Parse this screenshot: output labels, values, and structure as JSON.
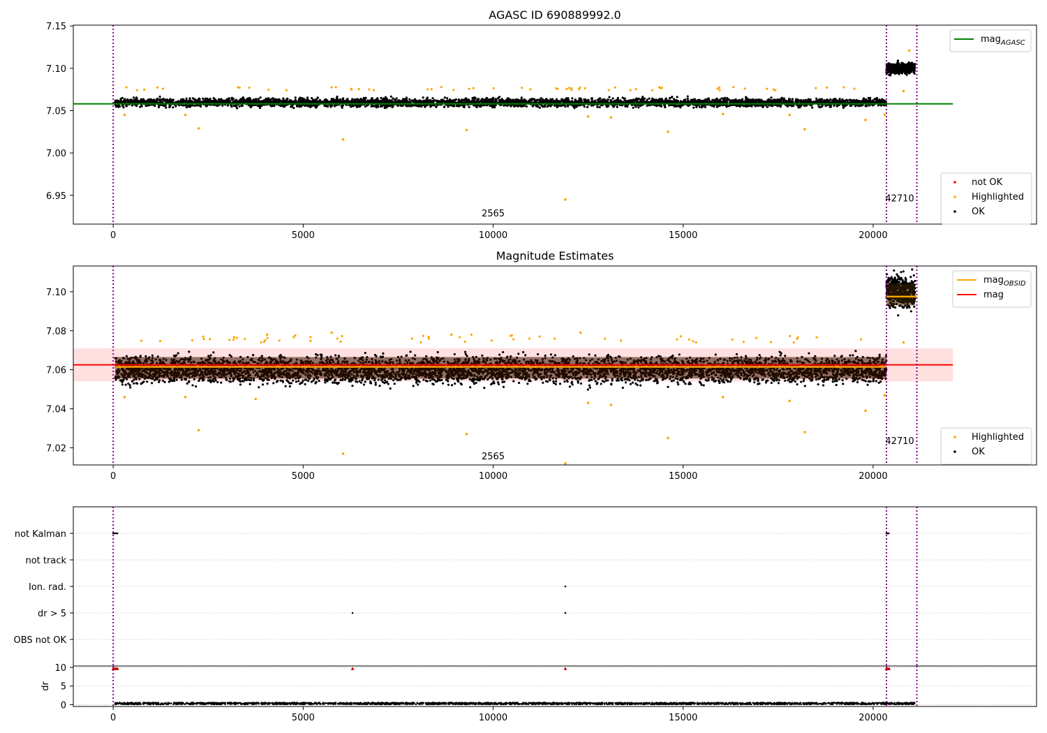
{
  "figure": {
    "title": "AGASC ID 690889992.0"
  },
  "chart_data": [
    {
      "type": "scatter",
      "title": "AGASC ID 690889992.0",
      "xlim": [
        -1050,
        24300
      ],
      "ylim": [
        6.916,
        7.151
      ],
      "x_ticks": [
        0,
        5000,
        10000,
        15000,
        20000
      ],
      "y_ticks": [
        6.95,
        7.0,
        7.05,
        7.1,
        7.15
      ],
      "y_tick_labels": [
        "6.95",
        "7.00",
        "7.05",
        "7.10",
        "7.15"
      ],
      "grid": false,
      "legend_upper": {
        "placement": "upper right",
        "entries": [
          {
            "label": "mag",
            "subscript": "AGASC",
            "color": "#008000"
          }
        ]
      },
      "legend_lower": {
        "placement": "lower right",
        "entries": [
          {
            "label": "not OK",
            "color": "#ff0000"
          },
          {
            "label": "Highlighted",
            "color": "#ffa500"
          },
          {
            "label": "OK",
            "color": "#000000"
          }
        ]
      },
      "series": [
        {
          "name": "mag",
          "kind": "hline",
          "y": 7.058,
          "x": [
            -1050,
            22100
          ],
          "color": "#008000"
        },
        {
          "name": "OK",
          "kind": "band_points",
          "color": "#000000",
          "segments": [
            {
              "x": [
                50,
                20350
              ],
              "y_center": 7.0595,
              "y_halfwidth": 0.0075
            },
            {
              "x": [
                20350,
                21100
              ],
              "y_center": 7.1,
              "y_halfwidth": 0.01
            }
          ]
        },
        {
          "name": "Highlighted",
          "kind": "points",
          "color": "#ffa500",
          "points": [
            [
              300,
              7.045
            ],
            [
              2250,
              7.029
            ],
            [
              6050,
              7.016
            ],
            [
              9300,
              7.027
            ],
            [
              11900,
              6.945
            ],
            [
              14600,
              7.025
            ],
            [
              18200,
              7.028
            ],
            [
              19800,
              7.039
            ],
            [
              20800,
              7.073
            ],
            [
              20950,
              7.121
            ],
            [
              12500,
              7.043
            ],
            [
              13100,
              7.042
            ],
            [
              1900,
              7.045
            ],
            [
              16050,
              7.046
            ],
            [
              17800,
              7.045
            ],
            [
              20300,
              7.045
            ]
          ]
        }
      ],
      "annotations": [
        {
          "text": "2565",
          "x": 10000,
          "y": 6.925
        },
        {
          "text": "42710",
          "x": 20700,
          "y": 6.943
        }
      ],
      "vlines": [
        {
          "x": 0,
          "color": "#800080",
          "style": "dotted"
        },
        {
          "x": 20350,
          "color": "#800080",
          "style": "dotted"
        },
        {
          "x": 21150,
          "color": "#800080",
          "style": "dotted"
        }
      ]
    },
    {
      "type": "scatter",
      "title": "Magnitude Estimates",
      "xlim": [
        -1050,
        24300
      ],
      "ylim": [
        7.0112,
        7.1132
      ],
      "x_ticks": [
        0,
        5000,
        10000,
        15000,
        20000
      ],
      "y_ticks": [
        7.02,
        7.04,
        7.06,
        7.08,
        7.1
      ],
      "y_tick_labels": [
        "7.02",
        "7.04",
        "7.06",
        "7.08",
        "7.10"
      ],
      "grid": false,
      "legend_upper": {
        "placement": "upper right",
        "entries": [
          {
            "label": "mag",
            "subscript": "OBSID",
            "color": "#ffa500"
          },
          {
            "label": "mag",
            "subscript": "",
            "color": "#ff0000"
          }
        ]
      },
      "legend_lower": {
        "placement": "lower right",
        "entries": [
          {
            "label": "Highlighted",
            "color": "#ffa500"
          },
          {
            "label": "OK",
            "color": "#000000"
          }
        ]
      },
      "series": [
        {
          "name": "mag",
          "kind": "hline",
          "y": 7.0625,
          "x": [
            -1050,
            22100
          ],
          "color": "#ff0000",
          "band": [
            7.054,
            7.071
          ]
        },
        {
          "name": "mag_OBSID",
          "kind": "segments",
          "color": "#ffa500",
          "segments": [
            {
              "x": [
                50,
                20350
              ],
              "y": 7.0615
            },
            {
              "x": [
                20350,
                21150
              ],
              "y": 7.0975
            }
          ]
        },
        {
          "name": "OK",
          "kind": "band_points",
          "color": "#000000",
          "segments": [
            {
              "x": [
                50,
                20350
              ],
              "y_center": 7.06,
              "y_halfwidth": 0.0105
            },
            {
              "x": [
                20350,
                21100
              ],
              "y_center": 7.1,
              "y_halfwidth": 0.012
            }
          ]
        },
        {
          "name": "Highlighted",
          "kind": "points",
          "color": "#ffa500",
          "points": [
            [
              300,
              7.046
            ],
            [
              1900,
              7.046
            ],
            [
              2250,
              7.029
            ],
            [
              3750,
              7.045
            ],
            [
              6050,
              7.017
            ],
            [
              9300,
              7.027
            ],
            [
              11900,
              7.012
            ],
            [
              12500,
              7.043
            ],
            [
              13100,
              7.042
            ],
            [
              14600,
              7.025
            ],
            [
              16050,
              7.046
            ],
            [
              17800,
              7.044
            ],
            [
              18200,
              7.028
            ],
            [
              19800,
              7.039
            ],
            [
              20300,
              7.047
            ],
            [
              20800,
              7.074
            ],
            [
              5750,
              7.079
            ],
            [
              4050,
              7.078
            ],
            [
              8900,
              7.078
            ],
            [
              12300,
              7.079
            ]
          ]
        }
      ],
      "annotations": [
        {
          "text": "2565",
          "x": 10000,
          "y": 7.014
        },
        {
          "text": "42710",
          "x": 20700,
          "y": 7.022
        }
      ],
      "vlines": [
        {
          "x": 0,
          "color": "#800080",
          "style": "dotted"
        },
        {
          "x": 20350,
          "color": "#800080",
          "style": "dotted"
        },
        {
          "x": 21150,
          "color": "#800080",
          "style": "dotted"
        }
      ]
    },
    {
      "type": "scatter",
      "title": "",
      "xlim": [
        -1050,
        24300
      ],
      "x_ticks": [
        0,
        5000,
        10000,
        15000,
        20000
      ],
      "flags": {
        "categories": [
          "not Kalman",
          "not track",
          "Ion. rad.",
          "dr > 5",
          "OBS not OK"
        ],
        "points": [
          {
            "category": "not Kalman",
            "x": [
              0,
              40,
              80,
              110,
              20350,
              20380,
              20410
            ]
          },
          {
            "category": "Ion. rad.",
            "x": [
              11900
            ]
          },
          {
            "category": "dr > 5",
            "x": [
              6300,
              11900
            ]
          }
        ]
      },
      "dr": {
        "ylabel": "dr",
        "ylim": [
          -0.5,
          10.4
        ],
        "y_ticks": [
          0,
          5,
          10
        ],
        "y_tick_labels": [
          "0",
          "5",
          "10"
        ],
        "capped_markers": {
          "y": 9.8,
          "color": "#cc0000",
          "x": [
            0,
            30,
            70,
            110,
            6300,
            11900,
            20350,
            20380,
            20420
          ]
        },
        "baseline": {
          "x": [
            50,
            21100
          ],
          "y_center": 0.3,
          "y_halfwidth": 0.3,
          "color": "#000000"
        }
      },
      "vlines": [
        {
          "x": 0,
          "color": "#800080",
          "style": "dotted"
        },
        {
          "x": 20350,
          "color": "#800080",
          "style": "dotted"
        },
        {
          "x": 21150,
          "color": "#800080",
          "style": "dotted"
        }
      ]
    }
  ]
}
